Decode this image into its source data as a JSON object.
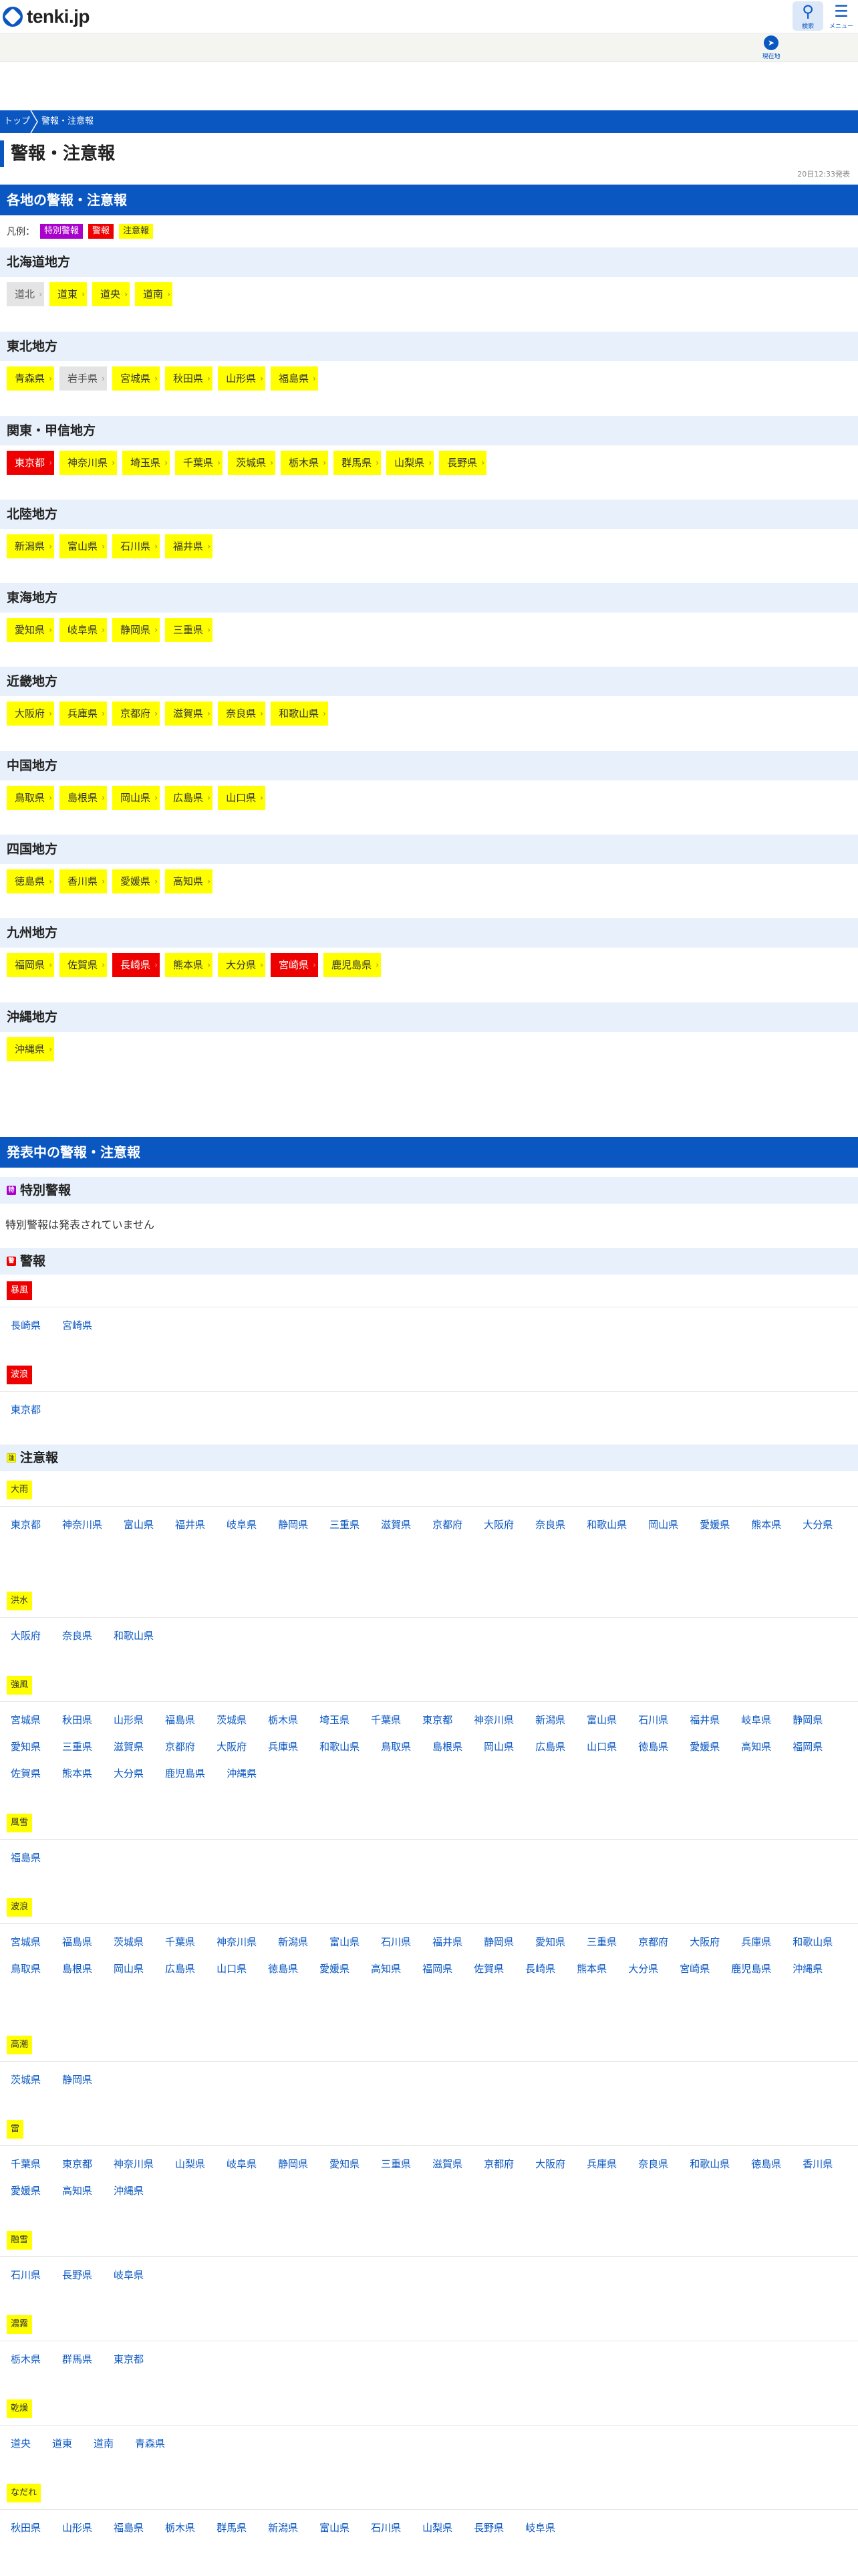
{
  "header": {
    "logo_text": "tenki.jp",
    "search_label": "検索",
    "menu_label": "メニュー",
    "location_label": "現在地"
  },
  "breadcrumb": [
    "トップ",
    "警報・注意報"
  ],
  "page_title": "警報・注意報",
  "date_text": "20日12:33発表",
  "regional": {
    "heading": "各地の警報・注意報",
    "legend_label": "凡例：",
    "legend": [
      "特別警報",
      "警報",
      "注意報"
    ],
    "regions": [
      {
        "name": "北海道地方",
        "prefs": [
          {
            "name": "道北",
            "level": "none"
          },
          {
            "name": "道東",
            "level": "advisory"
          },
          {
            "name": "道央",
            "level": "advisory"
          },
          {
            "name": "道南",
            "level": "advisory"
          }
        ]
      },
      {
        "name": "東北地方",
        "prefs": [
          {
            "name": "青森県",
            "level": "advisory"
          },
          {
            "name": "岩手県",
            "level": "none"
          },
          {
            "name": "宮城県",
            "level": "advisory"
          },
          {
            "name": "秋田県",
            "level": "advisory"
          },
          {
            "name": "山形県",
            "level": "advisory"
          },
          {
            "name": "福島県",
            "level": "advisory"
          }
        ]
      },
      {
        "name": "関東・甲信地方",
        "prefs": [
          {
            "name": "東京都",
            "level": "warning"
          },
          {
            "name": "神奈川県",
            "level": "advisory"
          },
          {
            "name": "埼玉県",
            "level": "advisory"
          },
          {
            "name": "千葉県",
            "level": "advisory"
          },
          {
            "name": "茨城県",
            "level": "advisory"
          },
          {
            "name": "栃木県",
            "level": "advisory"
          },
          {
            "name": "群馬県",
            "level": "advisory"
          },
          {
            "name": "山梨県",
            "level": "advisory"
          },
          {
            "name": "長野県",
            "level": "advisory"
          }
        ]
      },
      {
        "name": "北陸地方",
        "prefs": [
          {
            "name": "新潟県",
            "level": "advisory"
          },
          {
            "name": "富山県",
            "level": "advisory"
          },
          {
            "name": "石川県",
            "level": "advisory"
          },
          {
            "name": "福井県",
            "level": "advisory"
          }
        ]
      },
      {
        "name": "東海地方",
        "prefs": [
          {
            "name": "愛知県",
            "level": "advisory"
          },
          {
            "name": "岐阜県",
            "level": "advisory"
          },
          {
            "name": "静岡県",
            "level": "advisory"
          },
          {
            "name": "三重県",
            "level": "advisory"
          }
        ]
      },
      {
        "name": "近畿地方",
        "prefs": [
          {
            "name": "大阪府",
            "level": "advisory"
          },
          {
            "name": "兵庫県",
            "level": "advisory"
          },
          {
            "name": "京都府",
            "level": "advisory"
          },
          {
            "name": "滋賀県",
            "level": "advisory"
          },
          {
            "name": "奈良県",
            "level": "advisory"
          },
          {
            "name": "和歌山県",
            "level": "advisory"
          }
        ]
      },
      {
        "name": "中国地方",
        "prefs": [
          {
            "name": "鳥取県",
            "level": "advisory"
          },
          {
            "name": "島根県",
            "level": "advisory"
          },
          {
            "name": "岡山県",
            "level": "advisory"
          },
          {
            "name": "広島県",
            "level": "advisory"
          },
          {
            "name": "山口県",
            "level": "advisory"
          }
        ]
      },
      {
        "name": "四国地方",
        "prefs": [
          {
            "name": "徳島県",
            "level": "advisory"
          },
          {
            "name": "香川県",
            "level": "advisory"
          },
          {
            "name": "愛媛県",
            "level": "advisory"
          },
          {
            "name": "高知県",
            "level": "advisory"
          }
        ]
      },
      {
        "name": "九州地方",
        "prefs": [
          {
            "name": "福岡県",
            "level": "advisory"
          },
          {
            "name": "佐賀県",
            "level": "advisory"
          },
          {
            "name": "長崎県",
            "level": "warning"
          },
          {
            "name": "熊本県",
            "level": "advisory"
          },
          {
            "name": "大分県",
            "level": "advisory"
          },
          {
            "name": "宮崎県",
            "level": "warning"
          },
          {
            "name": "鹿児島県",
            "level": "advisory"
          }
        ]
      },
      {
        "name": "沖縄地方",
        "prefs": [
          {
            "name": "沖縄県",
            "level": "advisory"
          }
        ]
      }
    ]
  },
  "issued": {
    "heading": "発表中の警報・注意報",
    "special": {
      "mark": "特",
      "title": "特別警報",
      "none_text": "特別警報は発表されていません"
    },
    "warnings": {
      "mark": "警",
      "title": "警報",
      "kinds": [
        {
          "name": "暴風",
          "prefs": [
            "長崎県",
            "宮崎県"
          ]
        },
        {
          "name": "波浪",
          "prefs": [
            "東京都"
          ]
        }
      ]
    },
    "advisories": {
      "mark": "注",
      "title": "注意報",
      "kinds": [
        {
          "name": "大雨",
          "prefs": [
            "東京都",
            "神奈川県",
            "富山県",
            "福井県",
            "岐阜県",
            "静岡県",
            "三重県",
            "滋賀県",
            "京都府",
            "大阪府",
            "奈良県",
            "和歌山県",
            "岡山県",
            "愛媛県",
            "熊本県",
            "大分県"
          ]
        },
        {
          "name": "洪水",
          "prefs": [
            "大阪府",
            "奈良県",
            "和歌山県"
          ]
        },
        {
          "name": "強風",
          "prefs": [
            "宮城県",
            "秋田県",
            "山形県",
            "福島県",
            "茨城県",
            "栃木県",
            "埼玉県",
            "千葉県",
            "東京都",
            "神奈川県",
            "新潟県",
            "富山県",
            "石川県",
            "福井県",
            "岐阜県",
            "静岡県",
            "愛知県",
            "三重県",
            "滋賀県",
            "京都府",
            "大阪府",
            "兵庫県",
            "和歌山県",
            "鳥取県",
            "島根県",
            "岡山県",
            "広島県",
            "山口県",
            "徳島県",
            "愛媛県",
            "高知県",
            "福岡県",
            "佐賀県",
            "熊本県",
            "大分県",
            "鹿児島県",
            "沖縄県"
          ]
        },
        {
          "name": "風雪",
          "prefs": [
            "福島県"
          ]
        },
        {
          "name": "波浪",
          "prefs": [
            "宮城県",
            "福島県",
            "茨城県",
            "千葉県",
            "神奈川県",
            "新潟県",
            "富山県",
            "石川県",
            "福井県",
            "静岡県",
            "愛知県",
            "三重県",
            "京都府",
            "大阪府",
            "兵庫県",
            "和歌山県",
            "鳥取県",
            "島根県",
            "岡山県",
            "広島県",
            "山口県",
            "徳島県",
            "愛媛県",
            "高知県",
            "福岡県",
            "佐賀県",
            "長崎県",
            "熊本県",
            "大分県",
            "宮崎県",
            "鹿児島県",
            "沖縄県"
          ]
        },
        {
          "name": "高潮",
          "prefs": [
            "茨城県",
            "静岡県"
          ]
        },
        {
          "name": "雷",
          "prefs": [
            "千葉県",
            "東京都",
            "神奈川県",
            "山梨県",
            "岐阜県",
            "静岡県",
            "愛知県",
            "三重県",
            "滋賀県",
            "京都府",
            "大阪府",
            "兵庫県",
            "奈良県",
            "和歌山県",
            "徳島県",
            "香川県",
            "愛媛県",
            "高知県",
            "沖縄県"
          ]
        },
        {
          "name": "融雪",
          "prefs": [
            "石川県",
            "長野県",
            "岐阜県"
          ]
        },
        {
          "name": "濃霧",
          "prefs": [
            "栃木県",
            "群馬県",
            "東京都"
          ]
        },
        {
          "name": "乾燥",
          "prefs": [
            "道央",
            "道東",
            "道南",
            "青森県"
          ]
        },
        {
          "name": "なだれ",
          "prefs": [
            "秋田県",
            "山形県",
            "福島県",
            "栃木県",
            "群馬県",
            "新潟県",
            "富山県",
            "石川県",
            "山梨県",
            "長野県",
            "岐阜県"
          ]
        }
      ]
    }
  },
  "colors": {
    "brand": "#0a57c2",
    "warning": "#ee0000",
    "advisory": "#ffff00",
    "special": "#aa00cc"
  }
}
